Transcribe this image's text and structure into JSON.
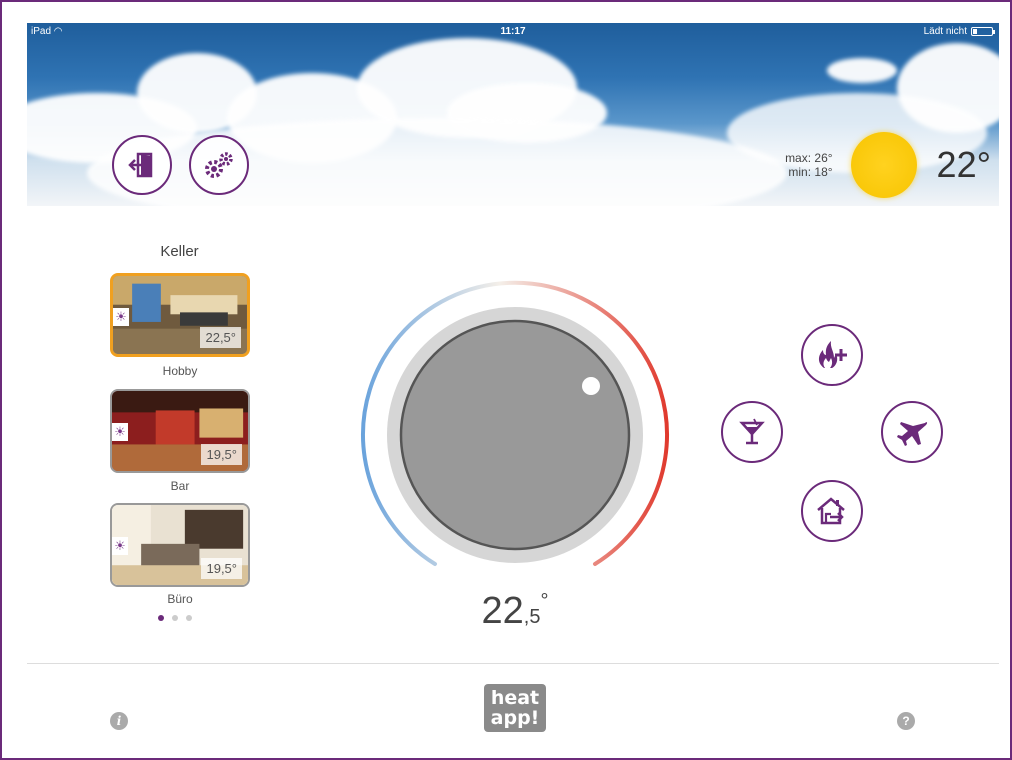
{
  "status_bar": {
    "carrier": "iPad",
    "time": "11:17",
    "battery_text": "Lädt nicht"
  },
  "header": {
    "icons": {
      "exit": "exit-door-icon",
      "settings": "gears-icon"
    },
    "weather": {
      "max": "max: 26°",
      "min": "min: 18°",
      "icon": "sun-icon",
      "temperature": "22°"
    }
  },
  "floor": {
    "name": "Keller"
  },
  "rooms": [
    {
      "name": "Hobby",
      "temperature": "22,5°",
      "active": true
    },
    {
      "name": "Bar",
      "temperature": "19,5°",
      "active": false
    },
    {
      "name": "Büro",
      "temperature": "19,5°",
      "active": false
    }
  ],
  "pagination": {
    "pages": 3,
    "current": 1
  },
  "thermostat": {
    "setpoint_whole": "22",
    "setpoint_fraction": ",5",
    "degree": "°"
  },
  "modes": [
    {
      "name": "boost",
      "icon": "flame-plus-icon"
    },
    {
      "name": "party",
      "icon": "cocktail-glass-icon"
    },
    {
      "name": "vacation",
      "icon": "airplane-icon"
    },
    {
      "name": "away",
      "icon": "house-leave-icon"
    }
  ],
  "footer": {
    "info_glyph": "i",
    "help_glyph": "?",
    "logo_line1": "heat",
    "logo_line2": "app!"
  },
  "colors": {
    "accent": "#6b2a7a",
    "active_room": "#f0a020",
    "sun": "#f7c400",
    "dial_cold": "#6aa3dc",
    "dial_hot": "#e03a2e"
  }
}
